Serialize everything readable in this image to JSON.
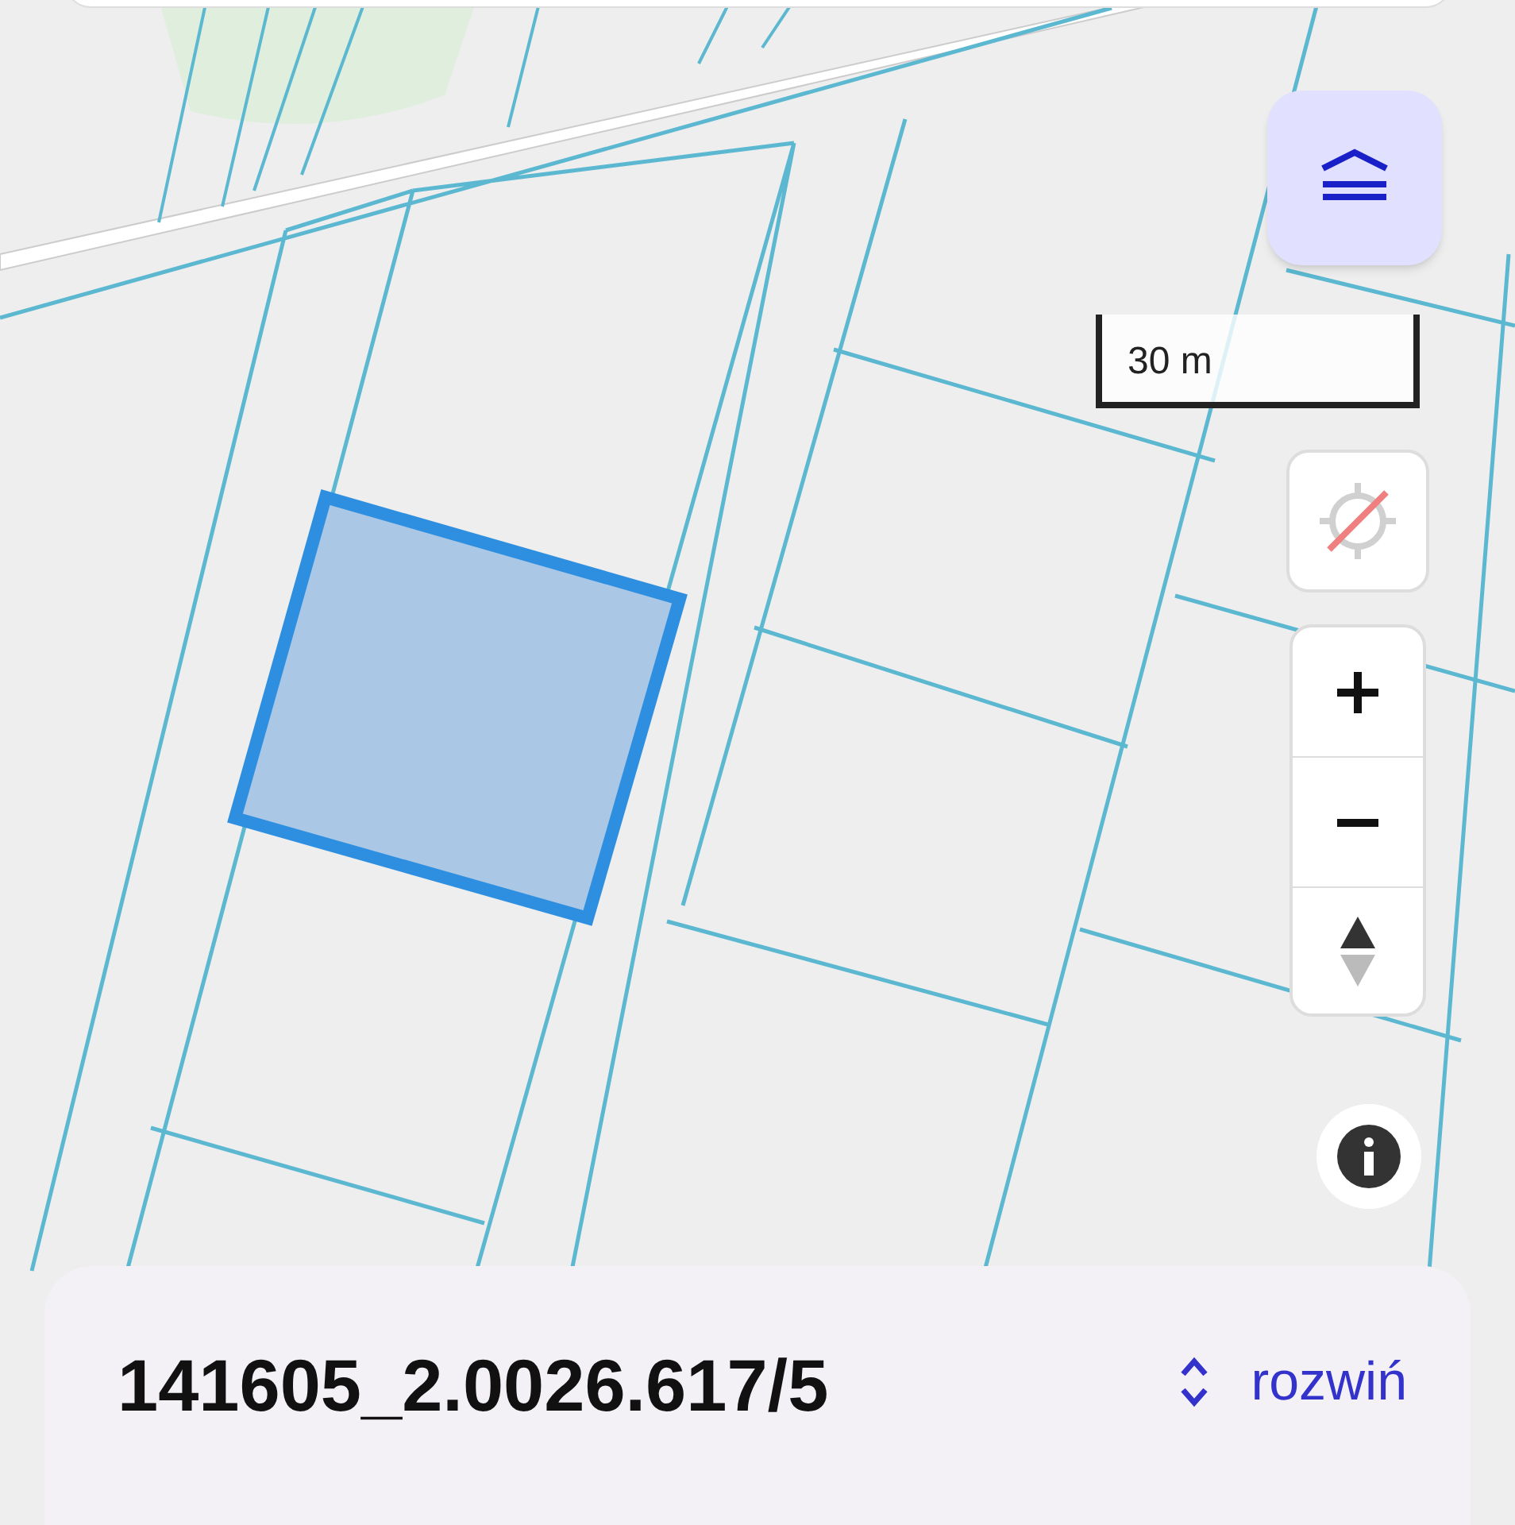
{
  "scale_bar": {
    "label": "30 m"
  },
  "bottom_sheet": {
    "parcel_id": "141605_2.0026.617/5",
    "expand_label": "rozwiń"
  }
}
